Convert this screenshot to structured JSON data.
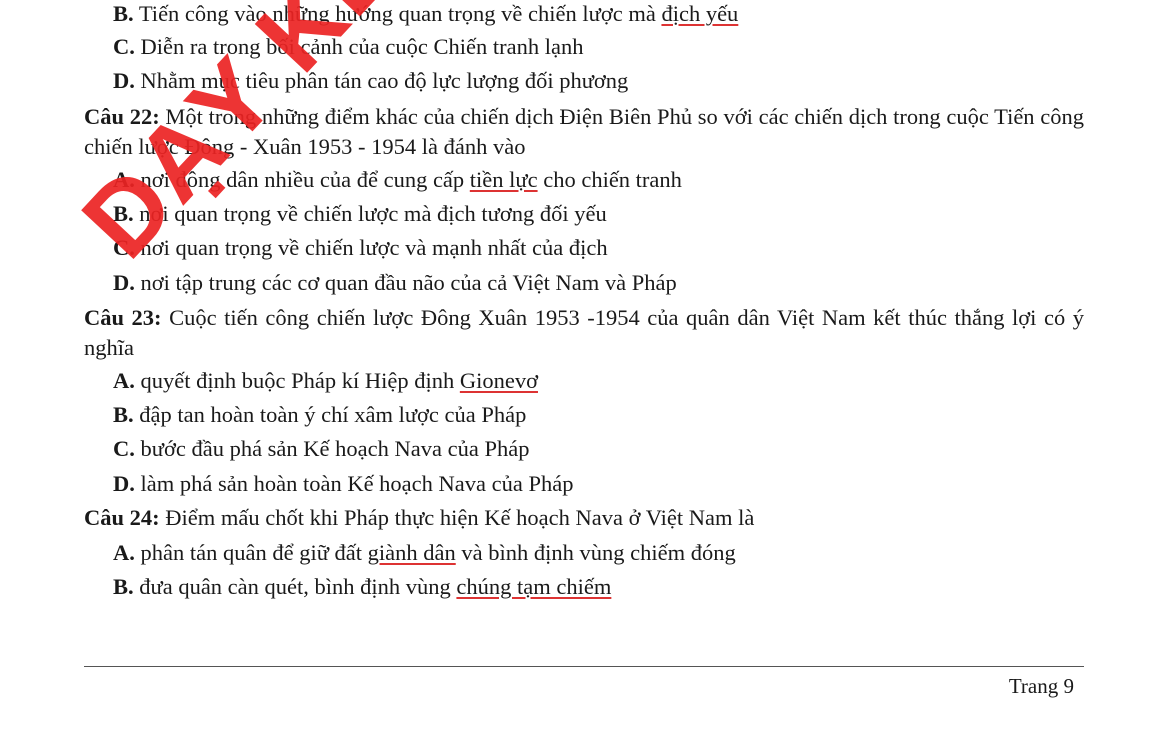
{
  "q21": {
    "b": {
      "letter": "B.",
      "pre": " Tiến công vào những hướng quan trọng về chiến lược mà ",
      "u": "địch yếu",
      "post": ""
    },
    "c": {
      "letter": "C.",
      "text": " Diễn ra trong bối cảnh của cuộc Chiến tranh lạnh"
    },
    "d": {
      "letter": "D.",
      "text": " Nhằm mục tiêu phân tán cao độ lực lượng đối phương"
    }
  },
  "q22": {
    "num": "Câu 22:",
    "text": " Một trong những điểm khác của chiến dịch Điện Biên Phủ so với các chiến dịch trong cuộc Tiến công chiến lược Đông - Xuân 1953 - 1954 là đánh vào",
    "a": {
      "letter": "A.",
      "pre": " nơi đông dân nhiều của để cung cấp ",
      "u": "tiền lực",
      "post": " cho chiến tranh"
    },
    "b": {
      "letter": "B.",
      "text": " nơi quan trọng về chiến lược mà địch tương đối yếu"
    },
    "c": {
      "letter": "C.",
      "text": " nơi quan trọng về chiến lược và mạnh nhất của địch"
    },
    "d": {
      "letter": "D.",
      "text": " nơi tập trung các cơ quan đầu não của cả Việt Nam và Pháp"
    }
  },
  "q23": {
    "num": "Câu 23:",
    "text": " Cuộc tiến công chiến lược Đông Xuân 1953 -1954 của quân dân Việt Nam kết thúc thắng lợi có ý nghĩa",
    "a": {
      "letter": "A.",
      "pre": " quyết định buộc Pháp kí Hiệp định ",
      "u": "Gionevơ",
      "post": ""
    },
    "b": {
      "letter": "B.",
      "text": " đập tan hoàn toàn ý chí xâm lược của Pháp"
    },
    "c": {
      "letter": "C.",
      "text": " bước đầu phá sản Kế hoạch Nava của Pháp"
    },
    "d": {
      "letter": "D.",
      "text": " làm phá sản hoàn toàn Kế hoạch Nava của Pháp"
    }
  },
  "q24": {
    "num": "Câu 24:",
    "text": " Điểm mấu chốt khi Pháp thực hiện Kế hoạch Nava ở Việt Nam là",
    "a": {
      "letter": "A.",
      "pre": " phân tán quân để giữ đất ",
      "u": "giành dân",
      "post": " và bình định vùng chiếm đóng"
    },
    "b": {
      "letter": "B.",
      "pre": " đưa quân càn quét, bình định vùng ",
      "u": "chúng tạm chiếm",
      "post": ""
    }
  },
  "watermark": "DẠY KÈM QUY NHƠN",
  "footer": {
    "page": "Trang 9"
  },
  "colors": {
    "watermark": "#eb2323",
    "spellcheck_underline": "#dd3333"
  }
}
